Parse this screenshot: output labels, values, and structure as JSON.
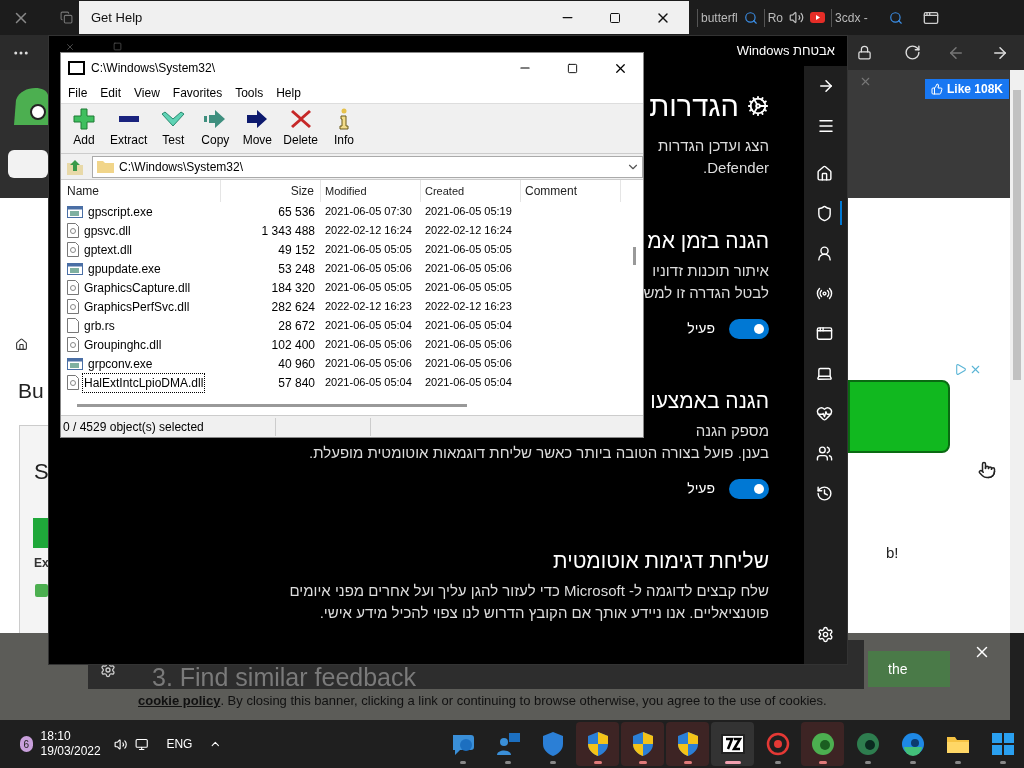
{
  "browser": {
    "tabs": [
      {
        "label": "butterfl"
      },
      {
        "label": "Ro"
      },
      {
        "label": "3cdx -"
      }
    ],
    "like_button": "Like 108K",
    "left_texts": [
      "Bu",
      "S",
      "Ex"
    ],
    "trailing_text": "b!"
  },
  "cookie_banner": {
    "button_text": "the",
    "link": "cookie policy",
    "text": ". By closing this banner, clicking a link or continuing to browse otherwise, you agree to the use of cookies."
  },
  "get_help": {
    "title": "Get Help",
    "step": "3. Find similar feedback"
  },
  "security": {
    "title": "אבטחת Windows",
    "heading": "הגדרות",
    "intro": [
      "הצג ועדכן הגדרות",
      "Defender."
    ],
    "sections": [
      {
        "heading": "הגנה בזמן אמ",
        "lines": [
          "איתור תוכנות זדוניו",
          "לבטל הגדרה זו למש"
        ],
        "toggle": {
          "label": "פעיל",
          "on": true
        }
      },
      {
        "heading": "הגנה באמצעו",
        "lines": [
          "מספק הגנה",
          "בענן. פועל בצורה הטובה ביותר כאשר שליחת דוגמאות אוטומטית מופעלת."
        ],
        "toggle": {
          "label": "פעיל",
          "on": true
        }
      },
      {
        "heading": "שליחת דגימות אוטומטית",
        "lines": [
          "שלח קבצים לדוגמה ל- Microsoft כדי לעזור להגן עליך ועל אחרים מפני איומים פוטנציאליים. אנו ניידע אותך אם הקובץ הדרוש לנו צפוי להכיל מידע אישי."
        ]
      }
    ],
    "nav": [
      {
        "kind": "home",
        "selected": false
      },
      {
        "kind": "shield",
        "selected": true
      },
      {
        "kind": "account",
        "selected": false
      },
      {
        "kind": "network",
        "selected": false
      },
      {
        "kind": "app",
        "selected": false
      },
      {
        "kind": "device",
        "selected": false
      },
      {
        "kind": "health",
        "selected": false
      },
      {
        "kind": "family",
        "selected": false
      },
      {
        "kind": "history",
        "selected": false
      }
    ]
  },
  "sevenzip": {
    "title": "C:\\Windows\\System32\\",
    "menu": [
      "File",
      "Edit",
      "View",
      "Favorites",
      "Tools",
      "Help"
    ],
    "toolbar": [
      {
        "kind": "add",
        "label": "Add"
      },
      {
        "kind": "extract",
        "label": "Extract"
      },
      {
        "kind": "test",
        "label": "Test"
      },
      {
        "kind": "copy",
        "label": "Copy"
      },
      {
        "kind": "move",
        "label": "Move"
      },
      {
        "kind": "delete",
        "label": "Delete"
      },
      {
        "kind": "info",
        "label": "Info"
      }
    ],
    "path": "C:\\Windows\\System32\\",
    "columns": [
      "Name",
      "Size",
      "Modified",
      "Created",
      "Comment"
    ],
    "rows": [
      {
        "kind": "exe",
        "name": "gpscript.exe",
        "size": "65 536",
        "modified": "2021-06-05 07:30",
        "created": "2021-06-05 05:19",
        "focused": false
      },
      {
        "kind": "dll",
        "name": "gpsvc.dll",
        "size": "1 343 488",
        "modified": "2022-02-12 16:24",
        "created": "2022-02-12 16:24",
        "focused": false
      },
      {
        "kind": "dll",
        "name": "gptext.dll",
        "size": "49 152",
        "modified": "2021-06-05 05:05",
        "created": "2021-06-05 05:05",
        "focused": false
      },
      {
        "kind": "exe",
        "name": "gpupdate.exe",
        "size": "53 248",
        "modified": "2021-06-05 05:06",
        "created": "2021-06-05 05:06",
        "focused": false
      },
      {
        "kind": "dll",
        "name": "GraphicsCapture.dll",
        "size": "184 320",
        "modified": "2021-06-05 05:05",
        "created": "2021-06-05 05:05",
        "focused": false
      },
      {
        "kind": "dll",
        "name": "GraphicsPerfSvc.dll",
        "size": "282 624",
        "modified": "2022-02-12 16:23",
        "created": "2022-02-12 16:23",
        "focused": false
      },
      {
        "kind": "file",
        "name": "grb.rs",
        "size": "28 672",
        "modified": "2021-06-05 05:04",
        "created": "2021-06-05 05:04",
        "focused": false
      },
      {
        "kind": "dll",
        "name": "Groupinghc.dll",
        "size": "102 400",
        "modified": "2021-06-05 05:06",
        "created": "2021-06-05 05:06",
        "focused": false
      },
      {
        "kind": "exe",
        "name": "grpconv.exe",
        "size": "40 960",
        "modified": "2021-06-05 05:06",
        "created": "2021-06-05 05:06",
        "focused": false
      },
      {
        "kind": "dll",
        "name": "HalExtIntcLpioDMA.dll",
        "size": "57 840",
        "modified": "2021-06-05 05:04",
        "created": "2021-06-05 05:04",
        "focused": true
      }
    ],
    "status": "0 / 4529 object(s) selected"
  },
  "taskbar": {
    "badge": "6",
    "time": "18:10",
    "date": "19/03/2022",
    "language": "ENG",
    "apps": [
      {
        "kind": "feedback",
        "flashing": false,
        "active": false
      },
      {
        "kind": "people",
        "flashing": false,
        "active": false
      },
      {
        "kind": "shield",
        "flashing": false,
        "active": false
      },
      {
        "kind": "uac",
        "flashing": true,
        "active": false
      },
      {
        "kind": "uac",
        "flashing": true,
        "active": false
      },
      {
        "kind": "uac",
        "flashing": true,
        "active": false
      },
      {
        "kind": "sevenzip",
        "flashing": false,
        "active": true
      },
      {
        "kind": "bug",
        "flashing": false,
        "active": false
      },
      {
        "kind": "edge-green",
        "flashing": true,
        "active": false
      },
      {
        "kind": "edge-dev",
        "flashing": false,
        "active": false
      },
      {
        "kind": "edge",
        "flashing": false,
        "active": false
      },
      {
        "kind": "folder",
        "flashing": false,
        "active": false
      },
      {
        "kind": "windows",
        "flashing": false,
        "active": false
      }
    ]
  }
}
